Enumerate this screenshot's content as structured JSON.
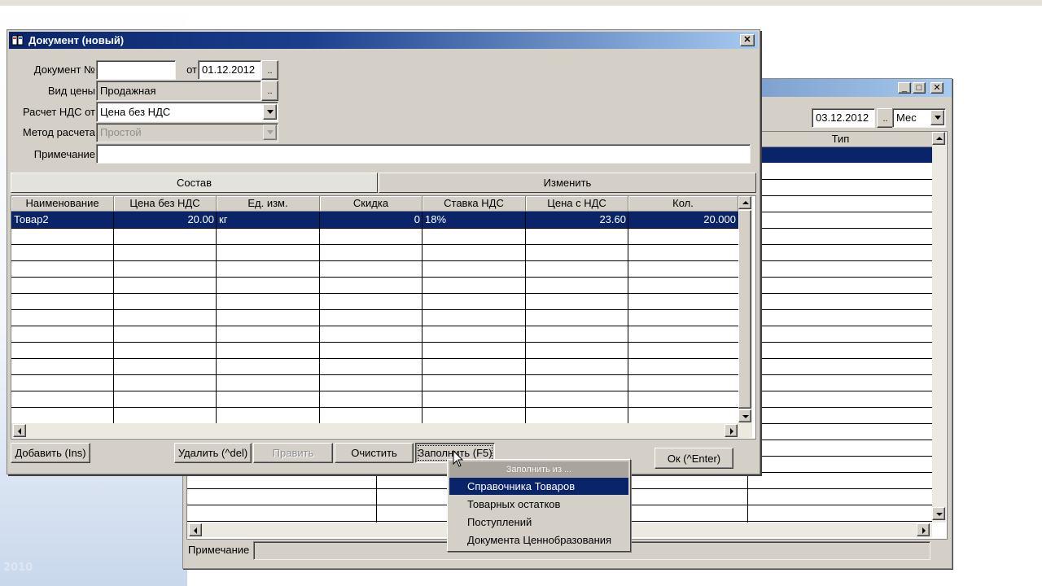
{
  "back_window": {
    "date_value": "03.12.2012",
    "ellipsis": "..",
    "period_value": "Мес",
    "column_header": "Тип",
    "note_label": "Примечание"
  },
  "dialog": {
    "title": "Документ (новый)",
    "close_glyph": "✕",
    "labels": {
      "doc_number": "Документ №",
      "from": "от",
      "price_type": "Вид цены",
      "vat_calc": "Расчет НДС от",
      "calc_method": "Метод расчета",
      "note": "Примечание"
    },
    "fields": {
      "doc_number": "",
      "doc_date": "01.12.2012",
      "price_type": "Продажная",
      "vat_calc": "Цена без НДС",
      "calc_method": "Простой",
      "note": ""
    },
    "ellipsis": "..",
    "tabs": [
      "Состав",
      "Изменить"
    ],
    "grid": {
      "headers": [
        "Наименование",
        "Цена без НДС",
        "Ед. изм.",
        "Скидка",
        "Ставка НДС",
        "Цена с НДС",
        "Кол."
      ],
      "rows": [
        [
          "Товар2",
          "20.00",
          "кг",
          "0",
          "18%",
          "23.60",
          "20.000"
        ]
      ]
    },
    "buttons": {
      "add": "Добавить (Ins)",
      "delete": "Удалить (^del)",
      "edit": "Править",
      "clear": "Очистить",
      "fill": "Заполнить (F5)",
      "ok": "Ок (^Enter)"
    }
  },
  "fill_menu": {
    "header": "Заполнить из ...",
    "items": [
      "Справочника Товаров",
      "Товарных остатков",
      "Поступлений",
      "Документа Ценнобразования"
    ]
  },
  "icons": {
    "window_icon": "document-book-icon",
    "cursor": "mouse-pointer-icon"
  },
  "colors": {
    "titlebar": "#0a246a",
    "selection": "#0a246a",
    "face": "#d4d0c8"
  }
}
